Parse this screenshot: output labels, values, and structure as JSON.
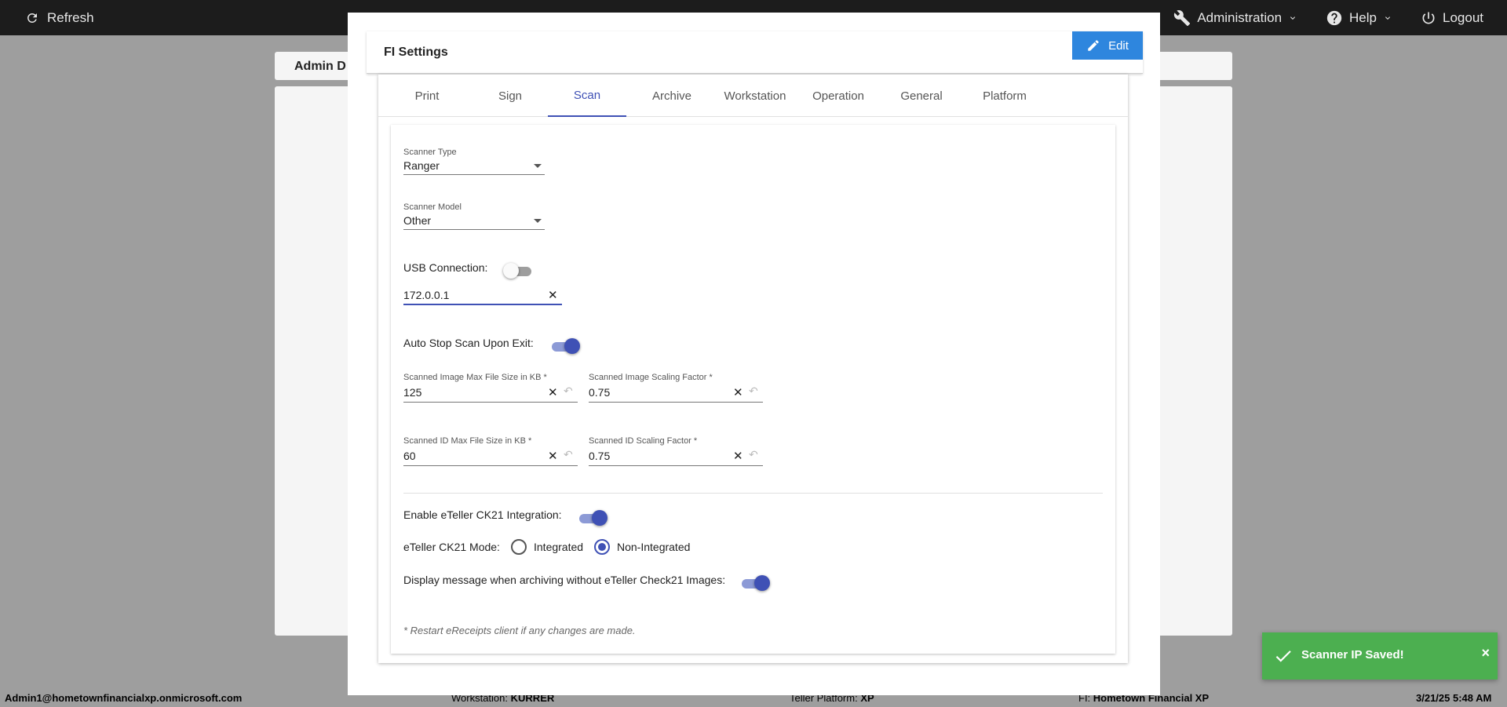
{
  "topbar": {
    "refresh_label": "Refresh",
    "administration_label": "Administration",
    "help_label": "Help",
    "logout_label": "Logout"
  },
  "background": {
    "panel_title": "Admin D"
  },
  "modal": {
    "title": "FI Settings",
    "edit_label": "Edit",
    "tabs": [
      "Print",
      "Sign",
      "Scan",
      "Archive",
      "Workstation",
      "Operation",
      "General",
      "Platform"
    ],
    "active_tab": "Scan"
  },
  "scan": {
    "scanner_type": {
      "label": "Scanner Type",
      "value": "Ranger"
    },
    "scanner_model": {
      "label": "Scanner Model",
      "value": "Other"
    },
    "usb_connection": {
      "label": "USB Connection:",
      "enabled": false
    },
    "scanner_ip": {
      "value": "172.0.0.1"
    },
    "auto_stop": {
      "label": "Auto Stop Scan Upon Exit:",
      "enabled": true
    },
    "image_max_size": {
      "label": "Scanned Image Max File Size in KB *",
      "value": "125"
    },
    "image_scaling": {
      "label": "Scanned Image Scaling Factor *",
      "value": "0.75"
    },
    "id_max_size": {
      "label": "Scanned ID Max File Size in KB *",
      "value": "60"
    },
    "id_scaling": {
      "label": "Scanned ID Scaling Factor *",
      "value": "0.75"
    },
    "ck21_integration": {
      "label": "Enable eTeller CK21 Integration:",
      "enabled": true
    },
    "ck21_mode": {
      "label": "eTeller CK21 Mode:",
      "options": [
        "Integrated",
        "Non-Integrated"
      ],
      "selected": "Non-Integrated"
    },
    "display_message": {
      "label": "Display message when archiving without eTeller Check21 Images:",
      "enabled": true
    },
    "note": "* Restart eReceipts client if any changes are made."
  },
  "statusbar": {
    "user": "Admin1@hometownfinancialxp.onmicrosoft.com",
    "workstation_label": "Workstation:",
    "workstation_value": "KURRER",
    "platform_label": "Teller Platform:",
    "platform_value": "XP",
    "fi_label": "FI:",
    "fi_value": "Hometown Financial XP",
    "datetime": "3/21/25 5:48 AM"
  },
  "toast": {
    "message": "Scanner IP Saved!",
    "close_glyph": "×"
  },
  "icons": {
    "clear": "✕",
    "undo": "↶",
    "check": "✓"
  },
  "colors": {
    "primary": "#3f51b5",
    "edit_button": "#2e86de",
    "toast_success": "#4caf50",
    "topbar": "#1c1c1c"
  }
}
